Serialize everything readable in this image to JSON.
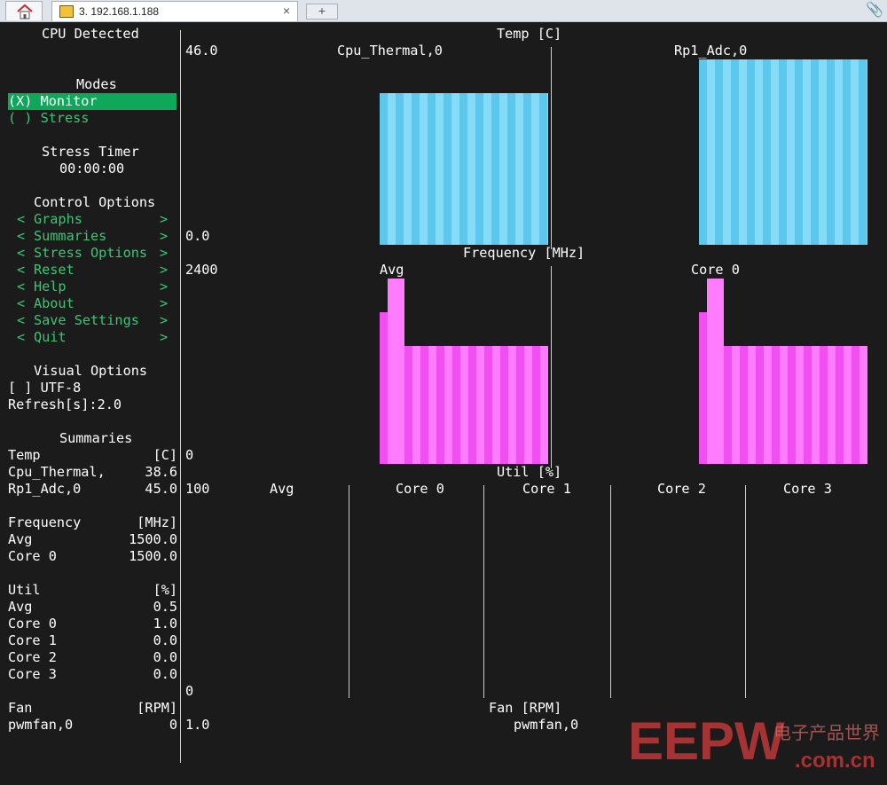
{
  "browser": {
    "tab_title": "3. 192.168.1.188",
    "close_glyph": "×",
    "new_tab_glyph": "+"
  },
  "sidebar": {
    "cpu_detected": "CPU Detected",
    "modes_title": "Modes",
    "modes": [
      {
        "mark": "(X)",
        "label": "Monitor",
        "selected": true
      },
      {
        "mark": "( )",
        "label": "Stress",
        "selected": false
      }
    ],
    "stress_timer_title": "Stress Timer",
    "stress_timer_value": "00:00:00",
    "control_title": "Control Options",
    "controls": [
      "Graphs",
      "Summaries",
      "Stress Options",
      "Reset",
      "Help",
      "About",
      "Save Settings",
      "Quit"
    ],
    "visual_title": "Visual Options",
    "utf8": "[ ] UTF-8",
    "refresh": "Refresh[s]:2.0",
    "summaries_title": "Summaries",
    "summary_rows": [
      {
        "label": "Temp",
        "value": "[C]"
      },
      {
        "label": "Cpu_Thermal,",
        "value": "38.6"
      },
      {
        "label": "Rp1_Adc,0",
        "value": "45.0"
      },
      {
        "label": "",
        "value": ""
      },
      {
        "label": "Frequency",
        "value": "[MHz]"
      },
      {
        "label": "Avg",
        "value": "1500.0"
      },
      {
        "label": "Core 0",
        "value": "1500.0"
      },
      {
        "label": "",
        "value": ""
      },
      {
        "label": "Util",
        "value": "[%]"
      },
      {
        "label": "Avg",
        "value": "0.5"
      },
      {
        "label": "Core 0",
        "value": "1.0"
      },
      {
        "label": "Core 1",
        "value": "0.0"
      },
      {
        "label": "Core 2",
        "value": "0.0"
      },
      {
        "label": "Core 3",
        "value": "0.0"
      },
      {
        "label": "",
        "value": ""
      },
      {
        "label": "Fan",
        "value": "[RPM]"
      },
      {
        "label": "pwmfan,0",
        "value": "0"
      }
    ]
  },
  "graphs": {
    "temp": {
      "title": "Temp [C]",
      "ymax": "46.0",
      "ymin": "0.0",
      "panels": [
        {
          "name": "Cpu_Thermal,0",
          "level": 0.9
        },
        {
          "name": "Rp1_Adc,0",
          "level": 1.0
        }
      ]
    },
    "frequency": {
      "title": "Frequency [MHz]",
      "ymax": "2400",
      "ymin": "0",
      "panels": [
        {
          "name": "Avg"
        },
        {
          "name": "Core 0"
        }
      ]
    },
    "util": {
      "title": "Util [%]",
      "ymax": "100",
      "ymin": "0",
      "panels": [
        "Avg",
        "Core 0",
        "Core 1",
        "Core 2",
        "Core 3"
      ]
    },
    "fan": {
      "title": "Fan [RPM]",
      "ymax": "1.0",
      "panels": [
        "pwmfan,0"
      ]
    }
  },
  "watermark": {
    "main": "EEPW",
    "chinese": "电子产品世界",
    "url": ".com.cn"
  },
  "colors": {
    "selected_bg": "#0fa75a",
    "menu_green": "#39c775",
    "temp_bar": "#5ec8ec",
    "freq_bar": "#f14ff2"
  }
}
